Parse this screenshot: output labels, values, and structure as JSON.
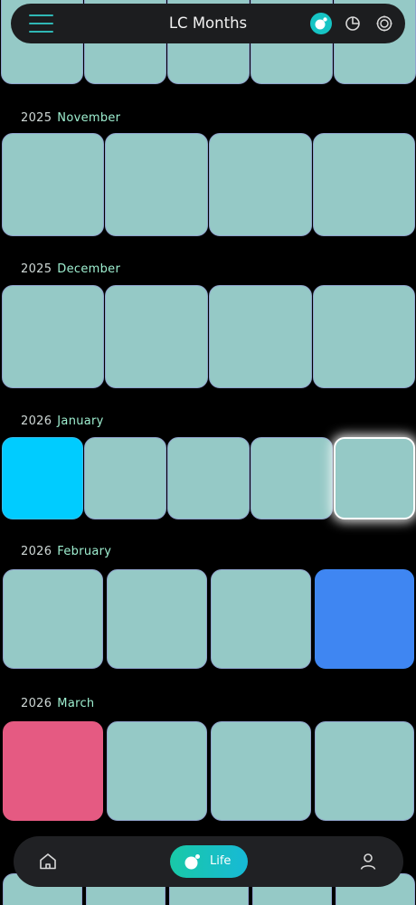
{
  "app": {
    "title": "LC Months"
  },
  "header": {
    "icons": [
      "menu-icon",
      "life-view-icon",
      "chart-view-icon",
      "settings-icon"
    ],
    "active_icon": "life-view-icon"
  },
  "months": [
    {
      "year": "2025",
      "month": "November",
      "tiles": 4,
      "states": [
        "default",
        "default",
        "default",
        "default"
      ]
    },
    {
      "year": "2025",
      "month": "December",
      "tiles": 4,
      "states": [
        "default",
        "default",
        "default",
        "default"
      ]
    },
    {
      "year": "2026",
      "month": "January",
      "tiles": 5,
      "states": [
        "current",
        "default",
        "default",
        "default",
        "selected"
      ]
    },
    {
      "year": "2026",
      "month": "February",
      "tiles": 4,
      "states": [
        "default",
        "default",
        "default",
        "blue"
      ]
    },
    {
      "year": "2026",
      "month": "March",
      "tiles": 4,
      "states": [
        "pink",
        "default",
        "default",
        "default"
      ]
    }
  ],
  "bottom_nav": {
    "items": [
      {
        "icon": "home-icon",
        "label": ""
      },
      {
        "icon": "life-icon",
        "label": "Life",
        "active": true
      },
      {
        "icon": "user-icon",
        "label": ""
      }
    ]
  },
  "colors": {
    "tile": "#95c9c6",
    "tile_border": "#8fa3cc",
    "current": "#00ccff",
    "blue": "#3f86f2",
    "pink": "#e55a82",
    "accent": "#16c4c4",
    "month_text": "#9eefd0"
  }
}
